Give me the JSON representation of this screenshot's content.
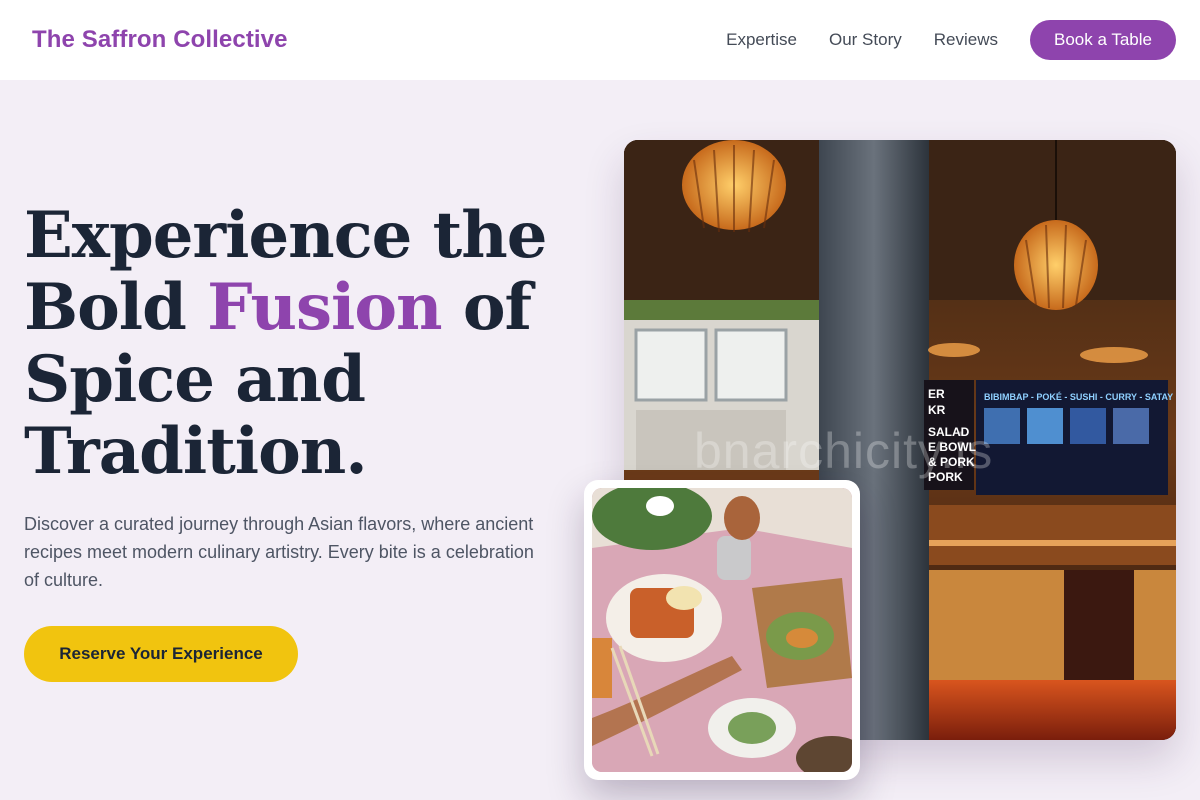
{
  "brand": {
    "name": "The Saffron Collective"
  },
  "nav": {
    "links": [
      "Expertise",
      "Our Story",
      "Reviews"
    ],
    "book_label": "Book a Table"
  },
  "hero": {
    "headline_part1": "Experience the Bold ",
    "headline_accent": "Fusion",
    "headline_part2": " of Spice and Tradition.",
    "subtext": "Discover a curated journey through Asian flavors, where ancient recipes meet modern culinary artistry. Every bite is a celebration of culture.",
    "cta_label": "Reserve Your Experience"
  },
  "images": {
    "main_menu_board": {
      "header": "BIBIMBAP - POKÉ - SUSHI - CURRY - SATAY",
      "side_items": [
        "ER",
        "KR",
        "SALAD",
        "E BOWL",
        "& PORK",
        "PORK"
      ]
    },
    "watermark": "bnarchicity.is"
  },
  "colors": {
    "brand": "#8e44ad",
    "cta": "#f1c40f",
    "heading": "#1b2536",
    "background": "#f3eef6"
  }
}
